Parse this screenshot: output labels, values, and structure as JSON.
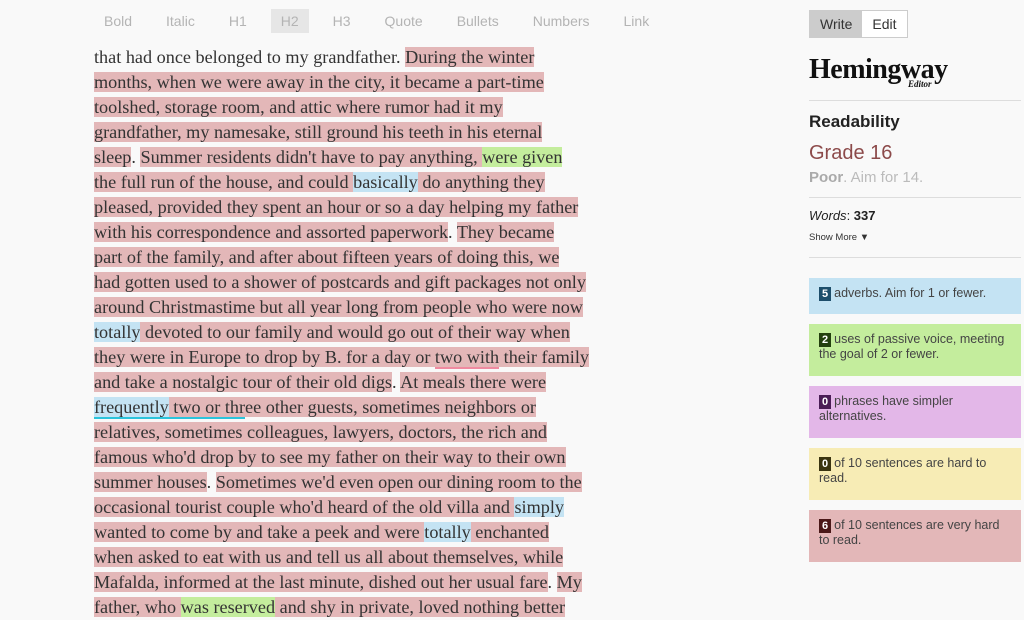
{
  "toolbar": {
    "buttons": [
      "Bold",
      "Italic",
      "H1",
      "H2",
      "H3",
      "Quote",
      "Bullets",
      "Numbers",
      "Link"
    ],
    "active": "H2"
  },
  "editor": {
    "lines": [
      [
        {
          "t": "that had once belonged to my grandfather. ",
          "c": ""
        },
        {
          "t": "During the winter",
          "c": "vh"
        }
      ],
      [
        {
          "t": "months, when we were away in the city, it became a part-time",
          "c": "vh"
        }
      ],
      [
        {
          "t": "toolshed, storage room, and attic where rumor had it my",
          "c": "vh"
        }
      ],
      [
        {
          "t": "grandfather, my namesake, still ground his teeth in his eternal",
          "c": "vh"
        }
      ],
      [
        {
          "t": "sleep",
          "c": "vh"
        },
        {
          "t": ". ",
          "c": ""
        },
        {
          "t": "Summer residents didn't have to pay anything, ",
          "c": "vh"
        },
        {
          "t": "were given",
          "c": "pas"
        }
      ],
      [
        {
          "t": "the full run of the house, and could ",
          "c": "vh"
        },
        {
          "t": "basically",
          "c": "adv"
        },
        {
          "t": " do anything they",
          "c": "vh"
        }
      ],
      [
        {
          "t": "pleased, provided they spent an hour or so a day helping my father",
          "c": "vh"
        }
      ],
      [
        {
          "t": "with his correspondence and assorted paperwork",
          "c": "vh"
        },
        {
          "t": ". ",
          "c": ""
        },
        {
          "t": "They became",
          "c": "vh"
        }
      ],
      [
        {
          "t": "part of the family, and after about fifteen years of doing this, we",
          "c": "vh"
        }
      ],
      [
        {
          "t": "had gotten used to a shower of postcards and gift packages not only",
          "c": "vh"
        }
      ],
      [
        {
          "t": "around Christmastime but all year long from people who were now",
          "c": "vh"
        }
      ],
      [
        {
          "t": "totally",
          "c": "adv"
        },
        {
          "t": " devoted to our family and would go out of their way when",
          "c": "vh"
        }
      ],
      [
        {
          "t": "they were in Europe to drop by B. for a day or ",
          "c": "vh"
        },
        {
          "t": "two  with",
          "c": "vh ul-pink"
        },
        {
          "t": " their family",
          "c": "vh"
        }
      ],
      [
        {
          "t": "and take a nostalgic tour of their old digs",
          "c": "vh"
        },
        {
          "t": ". ",
          "c": ""
        },
        {
          "t": "At meals there were",
          "c": "vh"
        }
      ],
      [
        {
          "t": "frequently",
          "c": "adv ul-cyan"
        },
        {
          "t": " two or thr",
          "c": "vh ul-cyan"
        },
        {
          "t": "ee other guests, sometimes neighbors or",
          "c": "vh"
        }
      ],
      [
        {
          "t": "relatives, sometimes colleagues, lawyers, doctors, the rich and",
          "c": "vh"
        }
      ],
      [
        {
          "t": "famous who'd drop by to see my father on their way to their own",
          "c": "vh"
        }
      ],
      [
        {
          "t": "summer houses",
          "c": "vh"
        },
        {
          "t": ". ",
          "c": ""
        },
        {
          "t": "Sometimes we'd even open our dining room to the",
          "c": "vh"
        }
      ],
      [
        {
          "t": "occasional tourist couple who'd heard of the old villa and ",
          "c": "vh"
        },
        {
          "t": "simply",
          "c": "adv"
        }
      ],
      [
        {
          "t": "wanted to come by and take a peek and were ",
          "c": "vh"
        },
        {
          "t": "totally",
          "c": "adv"
        },
        {
          "t": " enchanted",
          "c": "vh"
        }
      ],
      [
        {
          "t": "when asked to eat with us and tell us all about themselves, while",
          "c": "vh"
        }
      ],
      [
        {
          "t": "Mafalda, informed at the last minute, dished out her usual fare",
          "c": "vh"
        },
        {
          "t": ". ",
          "c": ""
        },
        {
          "t": "My",
          "c": "vh"
        }
      ],
      [
        {
          "t": "father, who ",
          "c": "vh"
        },
        {
          "t": "was reserved",
          "c": "pas"
        },
        {
          "t": " and shy in private, loved nothing better",
          "c": "vh"
        }
      ]
    ]
  },
  "sidebar": {
    "mode": {
      "write": "Write",
      "edit": "Edit",
      "active": "Write"
    },
    "logo": {
      "title": "Hemingway",
      "subtitle": "Editor"
    },
    "readability": {
      "heading": "Readability",
      "grade": "Grade 16",
      "rating": "Poor",
      "rating_note": ". Aim for 14."
    },
    "words_label": "Words",
    "words_count": "337",
    "show_more": "Show More",
    "stats": [
      {
        "count": "5",
        "text": "adverbs. Aim for 1 or fewer.",
        "bg": "#c4e3f3",
        "badge": "#1d4e6b"
      },
      {
        "count": "2",
        "text": "uses of passive voice, meeting the goal of 2 or fewer.",
        "bg": "#c4ed9d",
        "badge": "#23400e"
      },
      {
        "count": "0",
        "text": "phrases have simpler alternatives.",
        "bg": "#e3b7e8",
        "badge": "#4a1d56"
      },
      {
        "count": "0",
        "text": "of 10 sentences are hard to read.",
        "bg": "#f7ecb5",
        "badge": "#3a3410"
      },
      {
        "count": "6",
        "text": "of 10 sentences are very hard to read.",
        "bg": "#e3b7b8",
        "badge": "#4a1818"
      }
    ]
  }
}
